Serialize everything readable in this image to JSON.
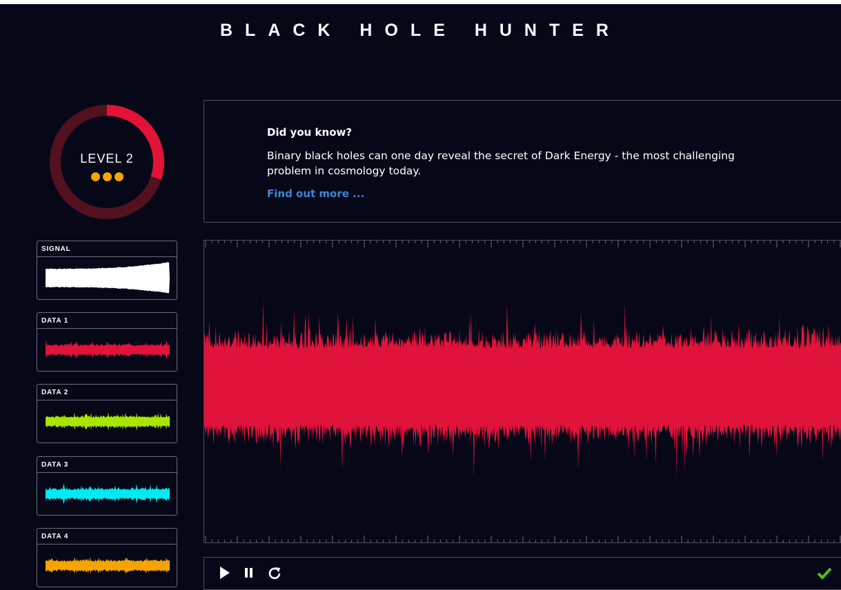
{
  "header": {
    "title": "BLACK HOLE HUNTER"
  },
  "level": {
    "label": "LEVEL 2",
    "dots": 3,
    "progress": 0.3,
    "ring_color": "#e21337",
    "ring_track_color": "#53101f"
  },
  "info": {
    "title": "Did you know?",
    "body": "Binary black holes can one day reveal the secret of Dark Energy - the most challenging problem in cosmology today.",
    "link": "Find out more ..."
  },
  "signals": [
    {
      "label": "SIGNAL",
      "color": "#ffffff",
      "kind": "chirp"
    },
    {
      "label": "DATA 1",
      "color": "#e0133a",
      "kind": "noise"
    },
    {
      "label": "DATA 2",
      "color": "#a8e600",
      "kind": "noise"
    },
    {
      "label": "DATA 3",
      "color": "#00eaf2",
      "kind": "noise"
    },
    {
      "label": "DATA 4",
      "color": "#f7a300",
      "kind": "noise"
    }
  ],
  "waveform": {
    "color": "#e0133a"
  },
  "controls": {
    "play": "play-icon",
    "pause": "pause-icon",
    "restart": "restart-icon",
    "confirm": "check-icon",
    "confirm_color": "#4fc414"
  }
}
